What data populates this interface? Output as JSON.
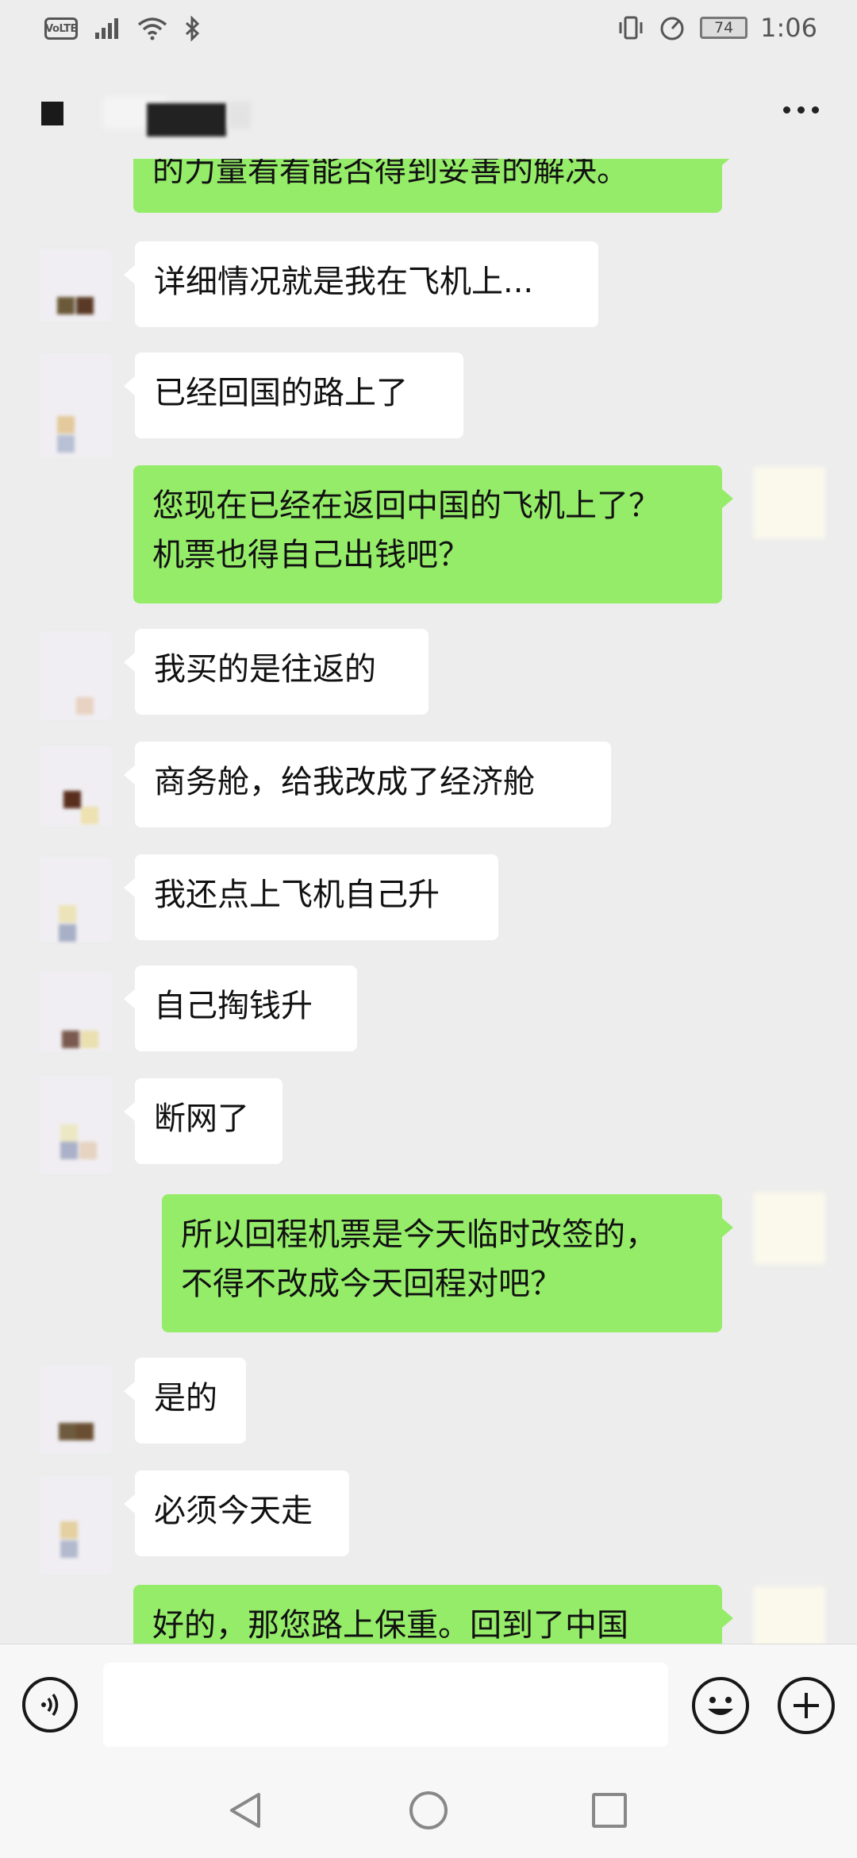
{
  "status_bar": {
    "volte": "VoLTE",
    "battery": "74",
    "time": "1:06"
  },
  "header": {
    "more_icon": "more-dots-icon"
  },
  "messages": [
    {
      "side": "sent",
      "text": "的力量看看能否得到妥善的解决。"
    },
    {
      "side": "recv",
      "text": "详细情况就是我在飞机上..."
    },
    {
      "side": "recv",
      "text": "已经回国的路上了"
    },
    {
      "side": "sent",
      "lines": [
        "您现在已经在返回中国的飞机上了？",
        "机票也得自己出钱吧？"
      ]
    },
    {
      "side": "recv",
      "text": "我买的是往返的"
    },
    {
      "side": "recv",
      "text": "商务舱，给我改成了经济舱"
    },
    {
      "side": "recv",
      "text": "我还点上飞机自己升"
    },
    {
      "side": "recv",
      "text": "自己掏钱升"
    },
    {
      "side": "recv",
      "text": "断网了"
    },
    {
      "side": "sent",
      "lines": [
        "所以回程机票是今天临时改签的，",
        "不得不改成今天回程对吧？"
      ]
    },
    {
      "side": "recv",
      "text": "是的"
    },
    {
      "side": "recv",
      "text": "必须今天走"
    },
    {
      "side": "sent",
      "text": "好的，那您路上保重。回到了中国"
    }
  ],
  "input_bar": {
    "voice_icon": "voice-icon",
    "input_value": "",
    "emoji_icon": "emoji-icon",
    "plus_icon": "plus-icon"
  },
  "nav_bar": {
    "back_icon": "back-triangle-icon",
    "home_icon": "home-circle-icon",
    "recent_icon": "recent-square-icon"
  },
  "colors": {
    "background": "#ededed",
    "sent_bubble": "#95ec69",
    "received_bubble": "#ffffff"
  }
}
